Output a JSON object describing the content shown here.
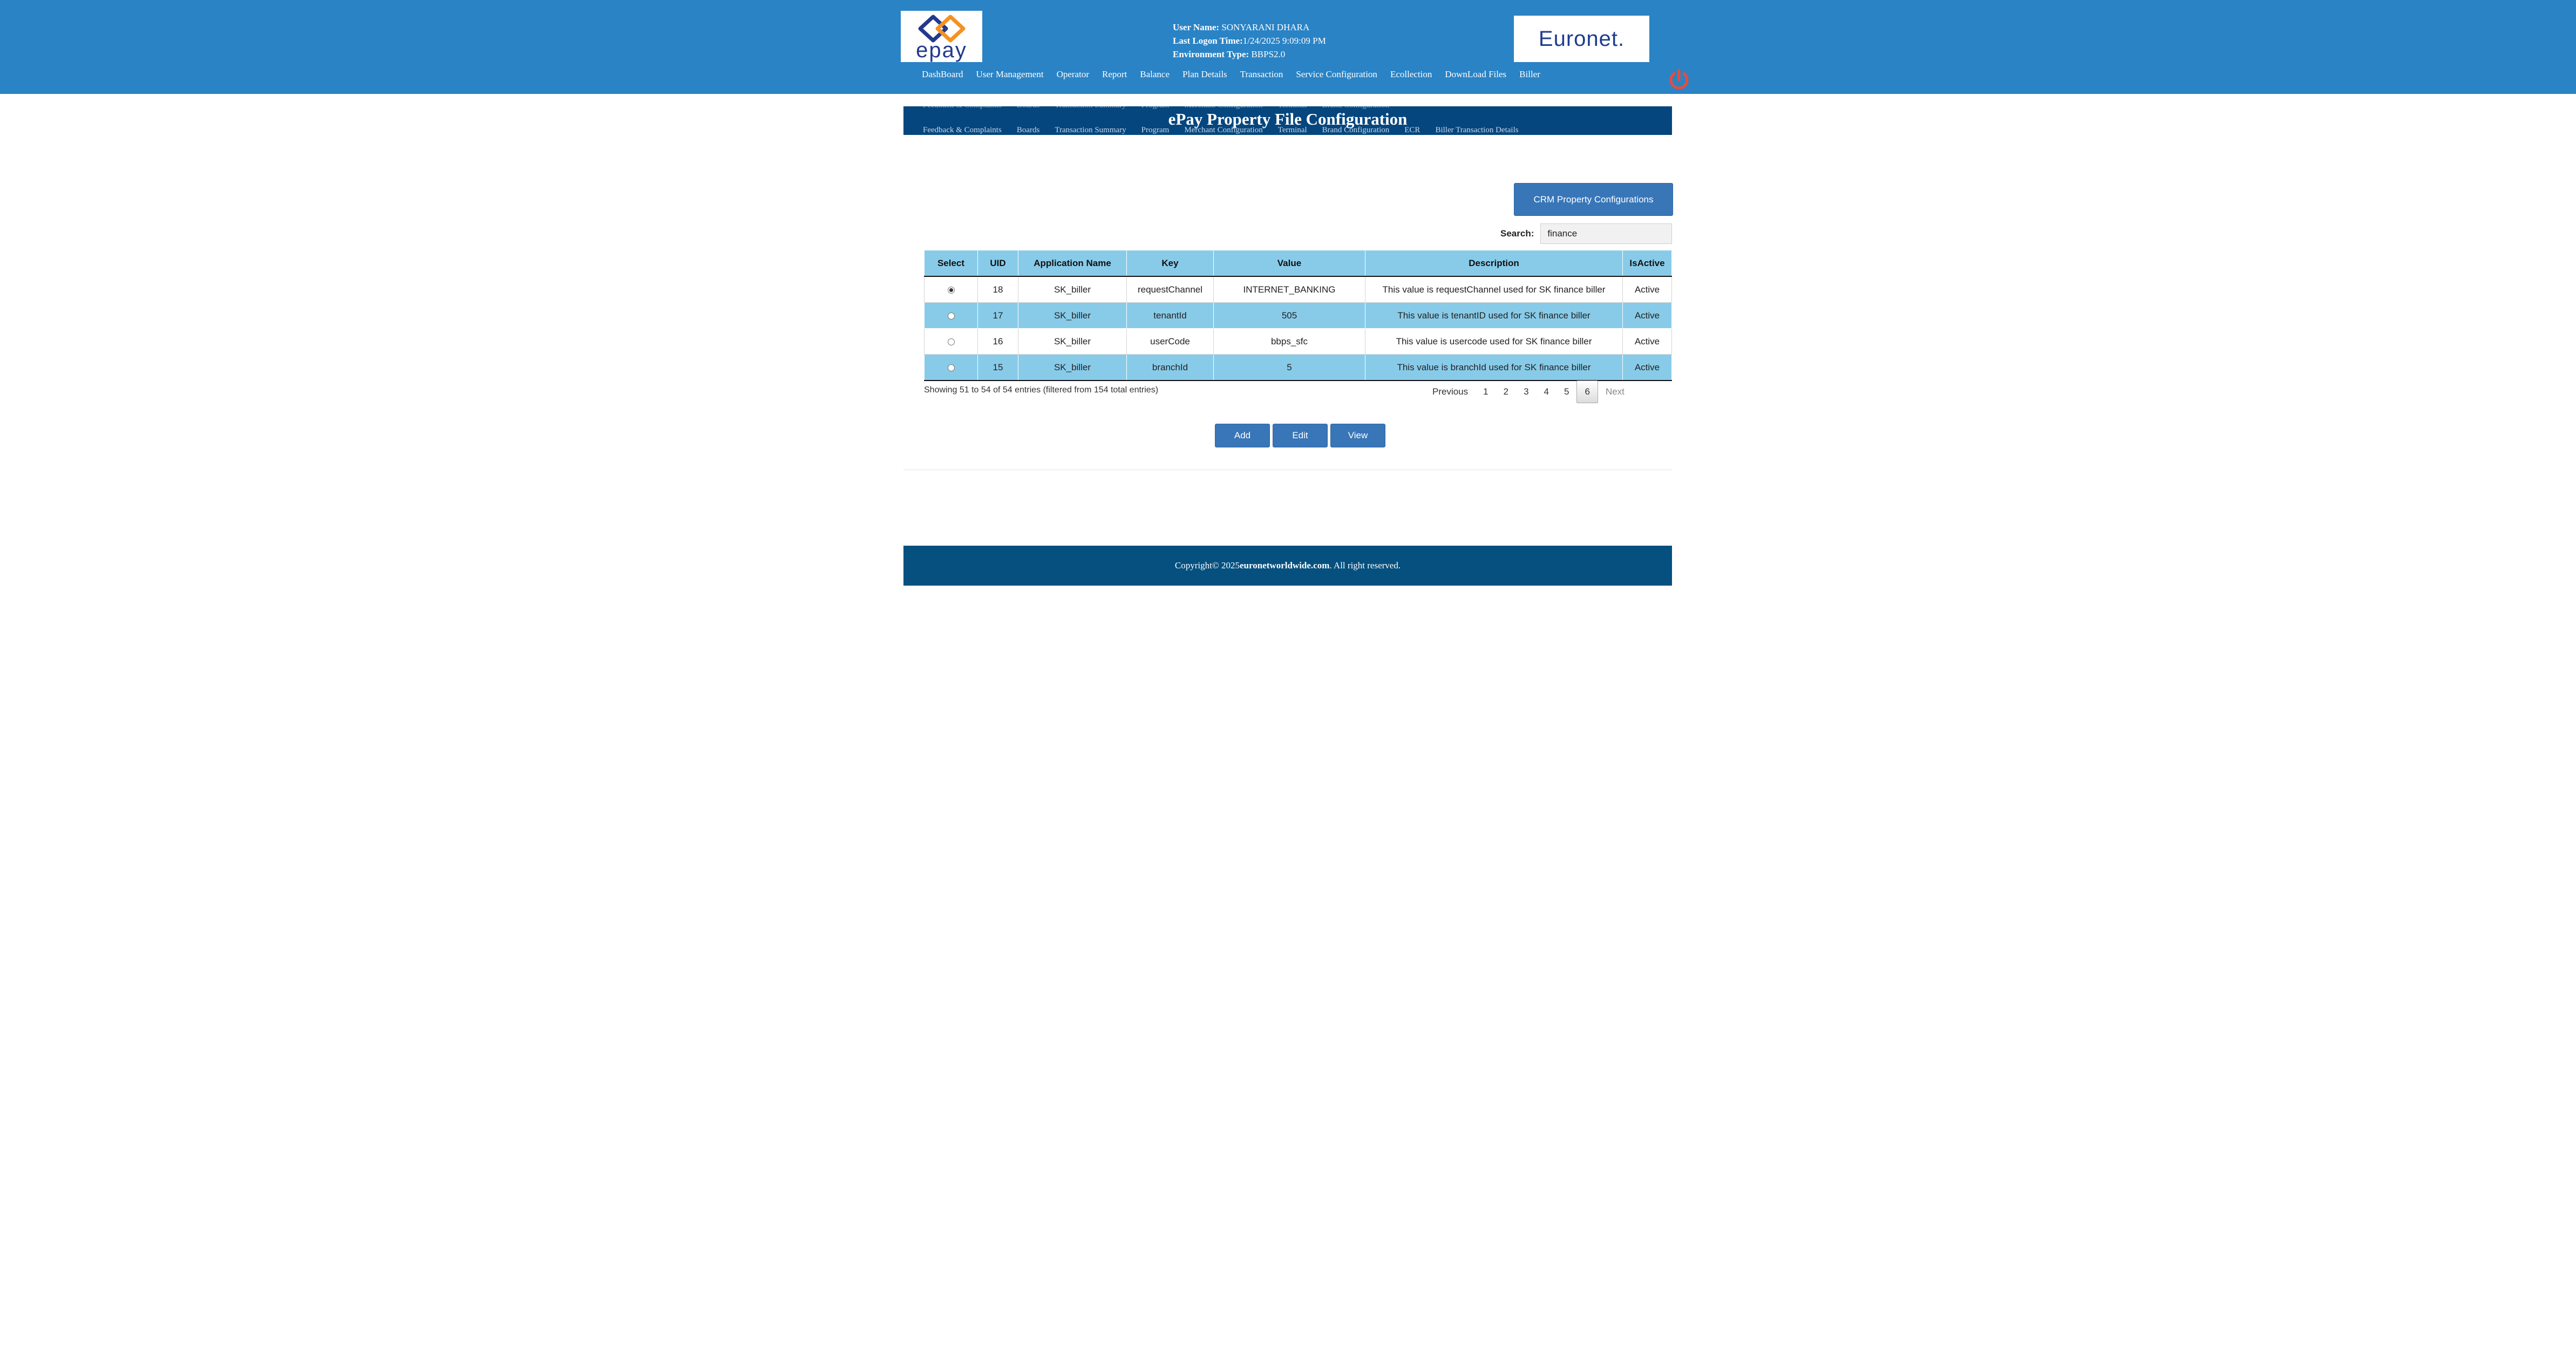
{
  "header": {
    "epay_logo_text": "epay",
    "euronet_logo_text": "Euronet.",
    "user_name_label": "User Name:",
    "user_name": "SONYARANI DHARA",
    "last_logon_label": "Last Logon Time:",
    "last_logon": "1/24/2025 9:09:09 PM",
    "env_label": "Environment Type:",
    "env_type": "BBPS2.0",
    "nav": [
      "DashBoard",
      "User Management",
      "Operator",
      "Report",
      "Balance",
      "Plan Details",
      "Transaction",
      "Service Configuration",
      "Ecollection",
      "DownLoad Files",
      "Biller"
    ],
    "colors": {
      "header_bg": "#2a83c5",
      "power_icon": "#e74c3c"
    }
  },
  "titlebar": {
    "title": "ePay Property File Configuration",
    "submenu": [
      "Feedback & Complaints",
      "Boards",
      "Transaction Summary",
      "Program",
      "Merchant Configuration",
      "Terminal",
      "Brand Configuration",
      "ECR",
      "Biller Transaction Details"
    ]
  },
  "crm_button": "CRM Property Configurations",
  "search": {
    "label": "Search:",
    "value": "finance"
  },
  "table": {
    "headers": [
      "Select",
      "UID",
      "Application Name",
      "Key",
      "Value",
      "Description",
      "IsActive"
    ],
    "rows": [
      {
        "uid": "18",
        "app": "SK_biller",
        "key": "requestChannel",
        "value": "INTERNET_BANKING",
        "desc": "This value is requestChannel used for SK finance biller",
        "active": "Active",
        "selected": true
      },
      {
        "uid": "17",
        "app": "SK_biller",
        "key": "tenantId",
        "value": "505",
        "desc": "This value is tenantID used for SK finance biller",
        "active": "Active",
        "selected": false
      },
      {
        "uid": "16",
        "app": "SK_biller",
        "key": "userCode",
        "value": "bbps_sfc",
        "desc": "This value is usercode used for SK finance biller",
        "active": "Active",
        "selected": false
      },
      {
        "uid": "15",
        "app": "SK_biller",
        "key": "branchId",
        "value": "5",
        "desc": "This value is branchId used for SK finance biller",
        "active": "Active",
        "selected": false
      }
    ]
  },
  "table_info": "Showing 51 to 54 of 54 entries (filtered from 154 total entries)",
  "pager": {
    "previous": "Previous",
    "pages": [
      "1",
      "2",
      "3",
      "4",
      "5",
      "6"
    ],
    "current": "6",
    "next": "Next"
  },
  "actions": {
    "add": "Add",
    "edit": "Edit",
    "view": "View"
  },
  "footer": {
    "prefix": "Copyright© 2025 ",
    "site": "euronetworldwide.com",
    "suffix": ". All right reserved."
  }
}
